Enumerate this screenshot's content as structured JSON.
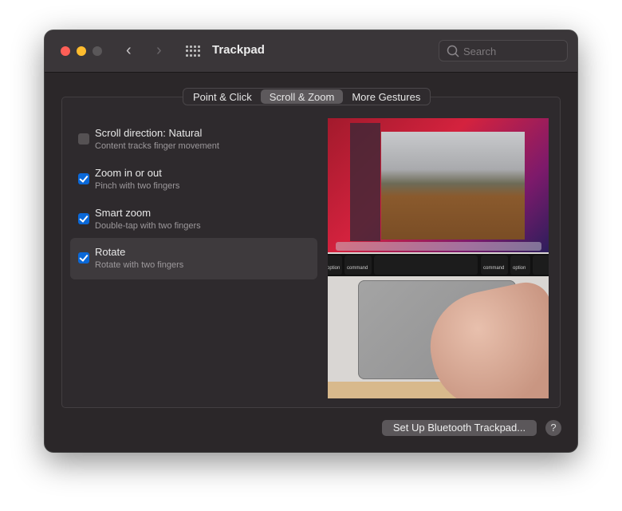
{
  "window": {
    "title": "Trackpad",
    "traffic_lights": {
      "close": "#fe5f57",
      "minimize": "#febc2e",
      "zoom": "#5a5759"
    }
  },
  "toolbar": {
    "back_icon": "chevron-left-icon",
    "forward_icon": "chevron-right-icon",
    "grid_icon": "show-all-grid-icon",
    "search": {
      "placeholder": "Search",
      "value": ""
    }
  },
  "tabs": [
    {
      "label": "Point & Click",
      "selected": false
    },
    {
      "label": "Scroll & Zoom",
      "selected": true
    },
    {
      "label": "More Gestures",
      "selected": false
    }
  ],
  "options": [
    {
      "label": "Scroll direction: Natural",
      "sub": "Content tracks finger movement",
      "checked": false
    },
    {
      "label": "Zoom in or out",
      "sub": "Pinch with two fingers",
      "checked": true
    },
    {
      "label": "Smart zoom",
      "sub": "Double-tap with two fingers",
      "checked": true
    },
    {
      "label": "Rotate",
      "sub": "Rotate with two fingers",
      "checked": true,
      "highlighted": true
    }
  ],
  "preview": {
    "keys": [
      "command",
      "option",
      "command",
      "option"
    ]
  },
  "footer": {
    "setup_button": "Set Up Bluetooth Trackpad...",
    "help": "?"
  },
  "colors": {
    "accent": "#0a68d8"
  }
}
